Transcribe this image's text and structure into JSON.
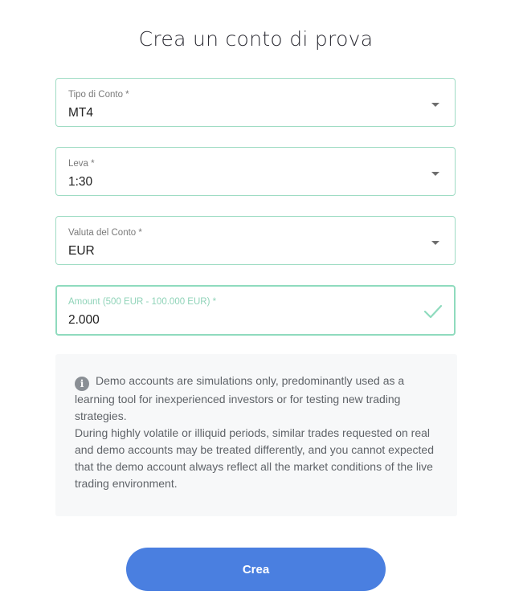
{
  "page": {
    "title": "Crea un conto di prova"
  },
  "form": {
    "account_type": {
      "label": "Tipo di Conto *",
      "value": "MT4",
      "icon": "chevron-down-icon"
    },
    "leverage": {
      "label": "Leva *",
      "value": "1:30",
      "icon": "chevron-down-icon"
    },
    "currency": {
      "label": "Valuta del Conto *",
      "value": "EUR",
      "icon": "chevron-down-icon"
    },
    "amount": {
      "label": "Amount (500 EUR - 100.000 EUR) *",
      "value": "2.000",
      "icon": "checkmark-icon"
    }
  },
  "notice": {
    "icon": "info-icon",
    "paragraph1": "Demo accounts are simulations only, predominantly used as a learning tool for inexperienced investors or for testing new trading strategies.",
    "paragraph2": "During highly volatile or illiquid periods, similar trades requested on real and demo accounts may be treated differently, and you cannot expected that the demo account always reflect all the market conditions of the live trading environment."
  },
  "actions": {
    "create_label": "Crea"
  },
  "colors": {
    "field_border": "#9fdcc4",
    "valid_accent": "#8fdbbe",
    "button_bg": "#4a7fe0",
    "notice_bg": "#f7f8f9"
  }
}
